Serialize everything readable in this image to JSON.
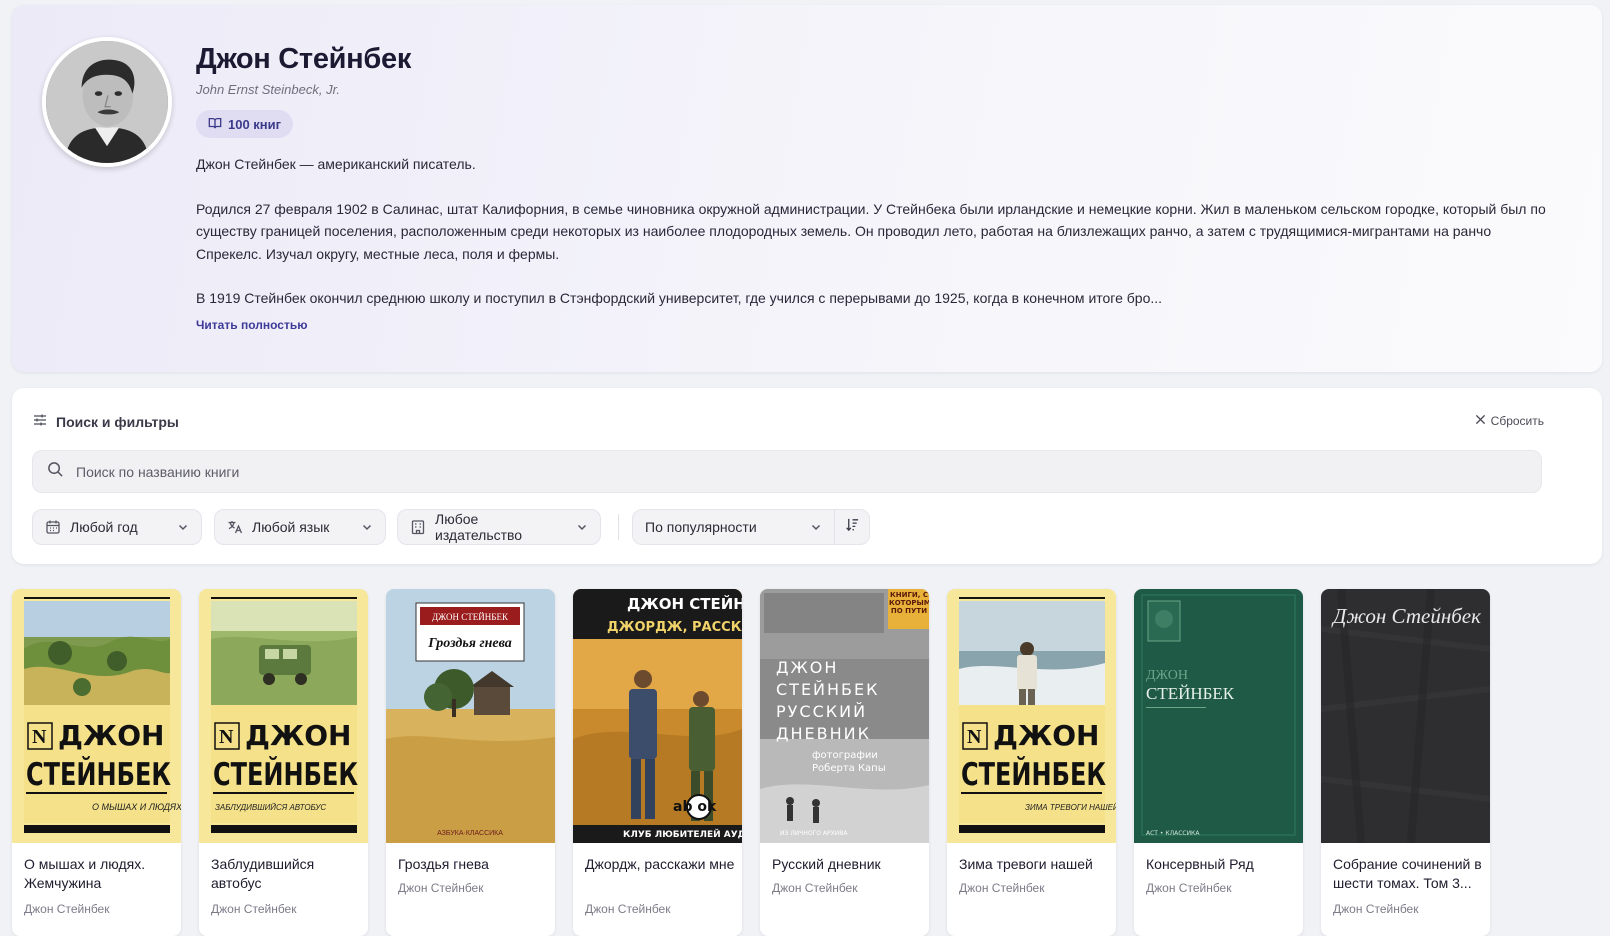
{
  "author": {
    "name": "Джон Стейнбек",
    "original_name": "John Ernst Steinbeck, Jr.",
    "books_count": "100 книг",
    "bio": [
      "Джон Стейнбек — американский писатель.",
      "Родился 27 февраля 1902 в Салинас, штат Калифорния, в семье чиновника окружной администрации. У Стейнбека были ирландские и немецкие корни. Жил в маленьком сельском городке, который был по существу границей поселения, расположенным среди некоторых из наиболее плодородных земель. Он проводил лето, работая на близлежащих ранчо, а затем с трудящимися-мигрантами на ранчо Спрекелс. Изучал округу, местные леса, поля и фермы.",
      "В 1919 Стейнбек окончил среднюю школу и поступил в Стэнфордский университет, где учился с перерывами до 1925, когда в конечном итоге бро..."
    ],
    "read_more": "Читать полностью"
  },
  "filters": {
    "title": "Поиск и фильтры",
    "reset": "Сбросить",
    "search_placeholder": "Поиск по названию книги",
    "year": "Любой год",
    "language": "Любой язык",
    "publisher": "Любое издательство",
    "sort": "По популярности"
  },
  "books": [
    {
      "title": "О мышах и людях. Жемчужина",
      "author": "Джон Стейнбек",
      "cover": {
        "publisher_mark": "N",
        "line1": "ДЖОН",
        "line2": "СТЕЙНБЕК",
        "subtitle": "О МЫШАХ И ЛЮДЯХ"
      }
    },
    {
      "title": "Заблудившийся автобус",
      "author": "Джон Стейнбек",
      "cover": {
        "publisher_mark": "N",
        "line1": "ДЖОН",
        "line2": "СТЕЙНБЕК",
        "subtitle": "ЗАБЛУДИВШИЙСЯ АВТОБУС"
      }
    },
    {
      "title": "Гроздья гнева",
      "author": "Джон Стейнбек",
      "cover": {
        "author": "ДЖОН СТЕЙНБЕК",
        "title": "Гроздья гнева",
        "series": "АЗБУКА·КЛАССИКА"
      }
    },
    {
      "title": "Джордж, расскажи мне",
      "author": "Джон Стейнбек",
      "cover": {
        "author": "ДЖОН СТЕЙН",
        "title": "ДЖОРДЖ, РАССКАЖ",
        "logo": "ab ok",
        "club": "КЛУБ ЛЮБИТЕЛЕЙ АУД"
      }
    },
    {
      "title": "Русский дневник",
      "author": "Джон Стейнбек",
      "cover": {
        "badge": "КНИГИ, С КОТОРЫМИ ПО ПУТИ",
        "lines": [
          "ДЖОН",
          "СТЕЙНБЕК",
          "РУССКИЙ",
          "ДНЕВНИК"
        ],
        "photos": "фотографии Роберта Капы",
        "archive": "ИЗ ЛИЧНОГО АРХИВА"
      }
    },
    {
      "title": "Зима тревоги нашей",
      "author": "Джон Стейнбек",
      "cover": {
        "publisher_mark": "N",
        "line1": "ДЖОН",
        "line2": "СТЕЙНБЕК",
        "subtitle": "ЗИМА ТРЕВОГИ НАШЕЙ"
      }
    },
    {
      "title": "Консервный Ряд",
      "author": "Джон Стейнбек",
      "cover": {
        "line1": "ДЖОН",
        "line2": "СТЕЙНБЕК",
        "series": "АСТ • КЛАССИКА"
      }
    },
    {
      "title": "Собрание сочинений в шести томах. Том 3...",
      "author": "Джон Стейнбек",
      "cover": {
        "signature": "Джон Стейнбек"
      }
    }
  ],
  "colors": {
    "accent": "#3d3a9a",
    "badge_bg": "#e0ddf3",
    "cover_yellow": "#f6e79a",
    "cover_green": "#1f5a46",
    "cover_dark": "#2e2e31"
  }
}
